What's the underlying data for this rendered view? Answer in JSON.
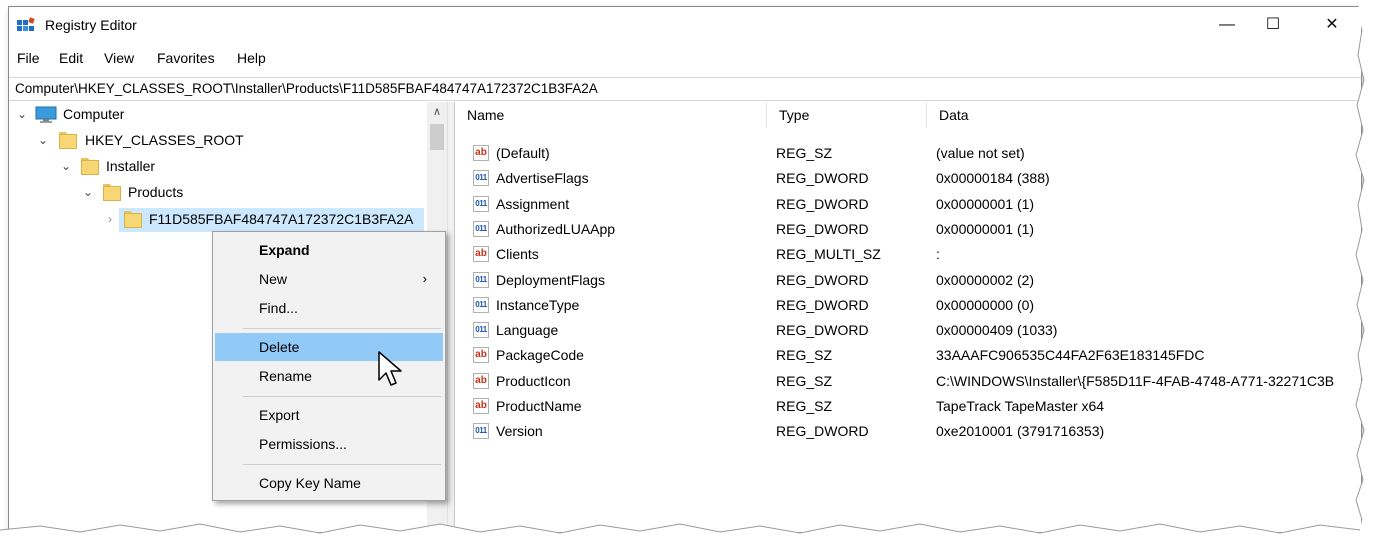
{
  "window": {
    "title": "Registry Editor",
    "minimize_glyph": "—",
    "maximize_glyph": "☐",
    "close_glyph": "✕"
  },
  "menu": [
    "File",
    "Edit",
    "View",
    "Favorites",
    "Help"
  ],
  "address": "Computer\\HKEY_CLASSES_ROOT\\Installer\\Products\\F11D585FBAF484747A172372C1B3FA2A",
  "tree": [
    {
      "label": "Computer",
      "icon": "computer-icon",
      "expanded": true
    },
    {
      "label": "HKEY_CLASSES_ROOT",
      "icon": "folder-icon",
      "expanded": true
    },
    {
      "label": "Installer",
      "icon": "folder-icon",
      "expanded": true
    },
    {
      "label": "Products",
      "icon": "folder-icon",
      "expanded": true
    },
    {
      "label": "F11D585FBAF484747A172372C1B3FA2A",
      "icon": "folder-icon",
      "expanded": false,
      "selected": true
    }
  ],
  "columns": [
    "Name",
    "Type",
    "Data"
  ],
  "values": [
    {
      "name": "(Default)",
      "type": "REG_SZ",
      "data": "(value not set)",
      "icon": "string-value-icon"
    },
    {
      "name": "AdvertiseFlags",
      "type": "REG_DWORD",
      "data": "0x00000184 (388)",
      "icon": "binary-value-icon"
    },
    {
      "name": "Assignment",
      "type": "REG_DWORD",
      "data": "0x00000001 (1)",
      "icon": "binary-value-icon"
    },
    {
      "name": "AuthorizedLUAApp",
      "type": "REG_DWORD",
      "data": "0x00000001 (1)",
      "icon": "binary-value-icon"
    },
    {
      "name": "Clients",
      "type": "REG_MULTI_SZ",
      "data": ":",
      "icon": "string-value-icon"
    },
    {
      "name": "DeploymentFlags",
      "type": "REG_DWORD",
      "data": "0x00000002 (2)",
      "icon": "binary-value-icon"
    },
    {
      "name": "InstanceType",
      "type": "REG_DWORD",
      "data": "0x00000000 (0)",
      "icon": "binary-value-icon"
    },
    {
      "name": "Language",
      "type": "REG_DWORD",
      "data": "0x00000409 (1033)",
      "icon": "binary-value-icon"
    },
    {
      "name": "PackageCode",
      "type": "REG_SZ",
      "data": "33AAAFC906535C44FA2F63E183145FDC",
      "icon": "string-value-icon"
    },
    {
      "name": "ProductIcon",
      "type": "REG_SZ",
      "data": "C:\\WINDOWS\\Installer\\{F585D11F-4FAB-4748-A771-32271C3B",
      "icon": "string-value-icon"
    },
    {
      "name": "ProductName",
      "type": "REG_SZ",
      "data": "TapeTrack TapeMaster x64",
      "icon": "string-value-icon"
    },
    {
      "name": "Version",
      "type": "REG_DWORD",
      "data": "0xe2010001 (3791716353)",
      "icon": "binary-value-icon"
    }
  ],
  "context_menu": [
    {
      "label": "Expand",
      "bold": true
    },
    {
      "label": "New",
      "submenu": true
    },
    {
      "label": "Find..."
    },
    {
      "label": "Delete",
      "highlighted": true
    },
    {
      "label": "Rename"
    },
    {
      "label": "Export"
    },
    {
      "label": "Permissions..."
    },
    {
      "label": "Copy Key Name"
    }
  ],
  "colors": {
    "selection": "#cce8ff",
    "menu_highlight": "#91c9f7",
    "string_icon": "#c8311b",
    "binary_icon": "#1b55b0"
  }
}
